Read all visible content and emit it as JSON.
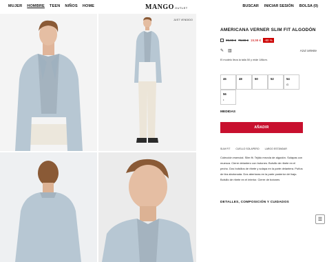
{
  "nav": {
    "items": [
      {
        "label": "MUJER"
      },
      {
        "label": "HOMBRE"
      },
      {
        "label": "TEEN"
      },
      {
        "label": "NIÑOS"
      },
      {
        "label": "HOME"
      }
    ]
  },
  "logo": {
    "text": "MANGO",
    "suffix": "OUTLET"
  },
  "header_actions": {
    "search": "BUSCAR",
    "login": "INICIAR SESIÓN",
    "bag": "BOLSA (0)"
  },
  "gallery": {
    "tag": "JUST VENDIDO"
  },
  "product": {
    "title": "AMERICANA VERNER SLIM FIT ALGODÓN",
    "price_original": "99,99 €",
    "price_previous": "79,99 €",
    "price_sale": "19,99 €",
    "discount": "-80 %",
    "color_name": "Azul celeste",
    "model_info": "El modelo lleva la talla 50 y mide 186cm."
  },
  "sizes": [
    {
      "label": "46",
      "note": ""
    },
    {
      "label": "48",
      "note": ""
    },
    {
      "label": "50",
      "note": ""
    },
    {
      "label": "52",
      "note": ""
    },
    {
      "label": "54",
      "note": "G"
    },
    {
      "label": "56",
      "note": "•"
    }
  ],
  "measurements_label": "MEDIDAS",
  "add_button": "AÑADIR",
  "tabs": [
    {
      "label": "SLIM FIT"
    },
    {
      "label": "CUELLO SOLAPERO"
    },
    {
      "label": "LARGO ESTÁNDAR"
    }
  ],
  "description": "Colección esencial. Slim fit. Tejido mezcla de algodón. Solapas con muesca. Cierre delantero con botones. Bolsillo de ribete en el pecho. Dos bolsillos de ribete y solapa en la parte delantera. Puños de tira abotonada. Dos aberturas en la parte posterior del bajo. Bolsillo de ribete en el interior. Cierre de botones",
  "details_heading": "DETALLES, COMPOSICIÓN Y CUIDADOS",
  "colors": {
    "accent": "#c8102e",
    "jacket": "#b7c7d3",
    "sweater": "#a4b3bf"
  },
  "icons": {
    "measure": "ruler-icon",
    "compare": "grid-icon",
    "box": "checkbox-icon",
    "chat": "chat-icon"
  }
}
